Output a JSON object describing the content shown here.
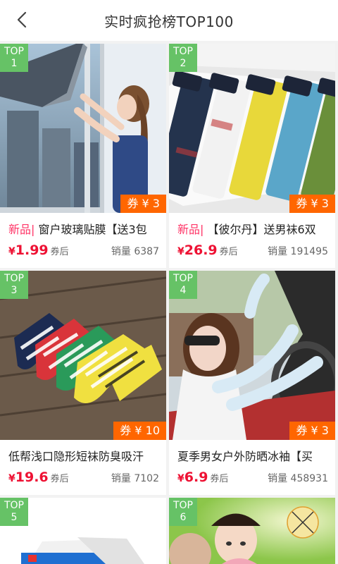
{
  "header": {
    "title": "实时疯抢榜TOP100"
  },
  "products": [
    {
      "rank_label": "TOP",
      "rank": "1",
      "tag": "新品|",
      "name": " 窗户玻璃贴膜【送3包",
      "currency": "¥",
      "price": "1.99",
      "price_note": "券后",
      "sales": "销量 6387",
      "coupon": "券 ¥ 3",
      "image": "window-film-photo"
    },
    {
      "rank_label": "TOP",
      "rank": "2",
      "tag": "新品|",
      "name": " 【彼尔丹】送男袜6双",
      "currency": "¥",
      "price": "26.9",
      "price_note": "券后",
      "sales": "销量 191495",
      "coupon": "券 ¥ 3",
      "image": "mens-underwear-box-photo"
    },
    {
      "rank_label": "TOP",
      "rank": "3",
      "tag": "",
      "name": "低帮浅口隐形短袜防臭吸汗",
      "currency": "¥",
      "price": "19.6",
      "price_note": "券后",
      "sales": "销量 7102",
      "coupon": "券 ¥ 10",
      "image": "striped-socks-photo"
    },
    {
      "rank_label": "TOP",
      "rank": "4",
      "tag": "",
      "name": "夏季男女户外防晒冰袖【买",
      "currency": "¥",
      "price": "6.9",
      "price_note": "券后",
      "sales": "销量 458931",
      "coupon": "券 ¥ 3",
      "image": "ice-sleeves-photo"
    },
    {
      "rank_label": "TOP",
      "rank": "5",
      "image": "box-product-photo"
    },
    {
      "rank_label": "TOP",
      "rank": "6",
      "image": "baby-mosquito-photo"
    }
  ]
}
